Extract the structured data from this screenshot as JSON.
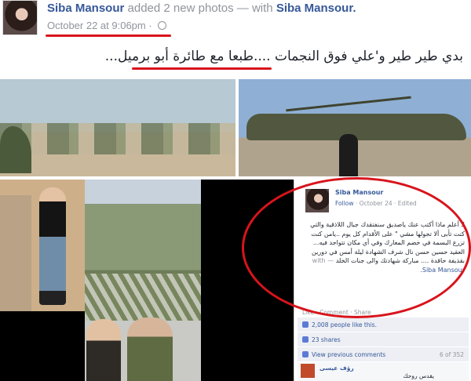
{
  "post": {
    "author": "Siba Mansour",
    "action": "added 2 new photos — with",
    "tagged": "Siba Mansour.",
    "timestamp": "October 22 at 9:06pm",
    "dot": "·",
    "caption": "بدي طير طير و'علي فوق النجمات ....طبعا مع طائرة أبو برميل..."
  },
  "embedded": {
    "author": "Siba Mansour",
    "follow": "Follow",
    "date": "October 24",
    "edited": "Edited",
    "text": "لا أعلم ماذا أكتب عنك ياصديق سنفتقدك جبال اللاذقية والتي كنت تأبى ألا تجولها مشي \" على الأقدام كل يوم ..يامن كنت تزرع البسمة في خضم المعارك وفي أي مكان تتواجد فيه... العقيد حسين حسن نال شرف الشهادة ليلة أمس في دورين بقذيفة حاقدة .... مباركة شهادتك والى جنات الخلد",
    "with": "— with",
    "with_name": "Siba Mansour.",
    "actions": "Like · Comment · Share",
    "likes": "2,008 people like this.",
    "shares": "23 shares",
    "view_prev": "View previous comments",
    "count": "6 of 352",
    "comment_name": "رؤف عيسى",
    "comment_text": "يقدس روحك"
  },
  "colors": {
    "annotation_red": "#d8141c",
    "link_blue": "#365899"
  }
}
